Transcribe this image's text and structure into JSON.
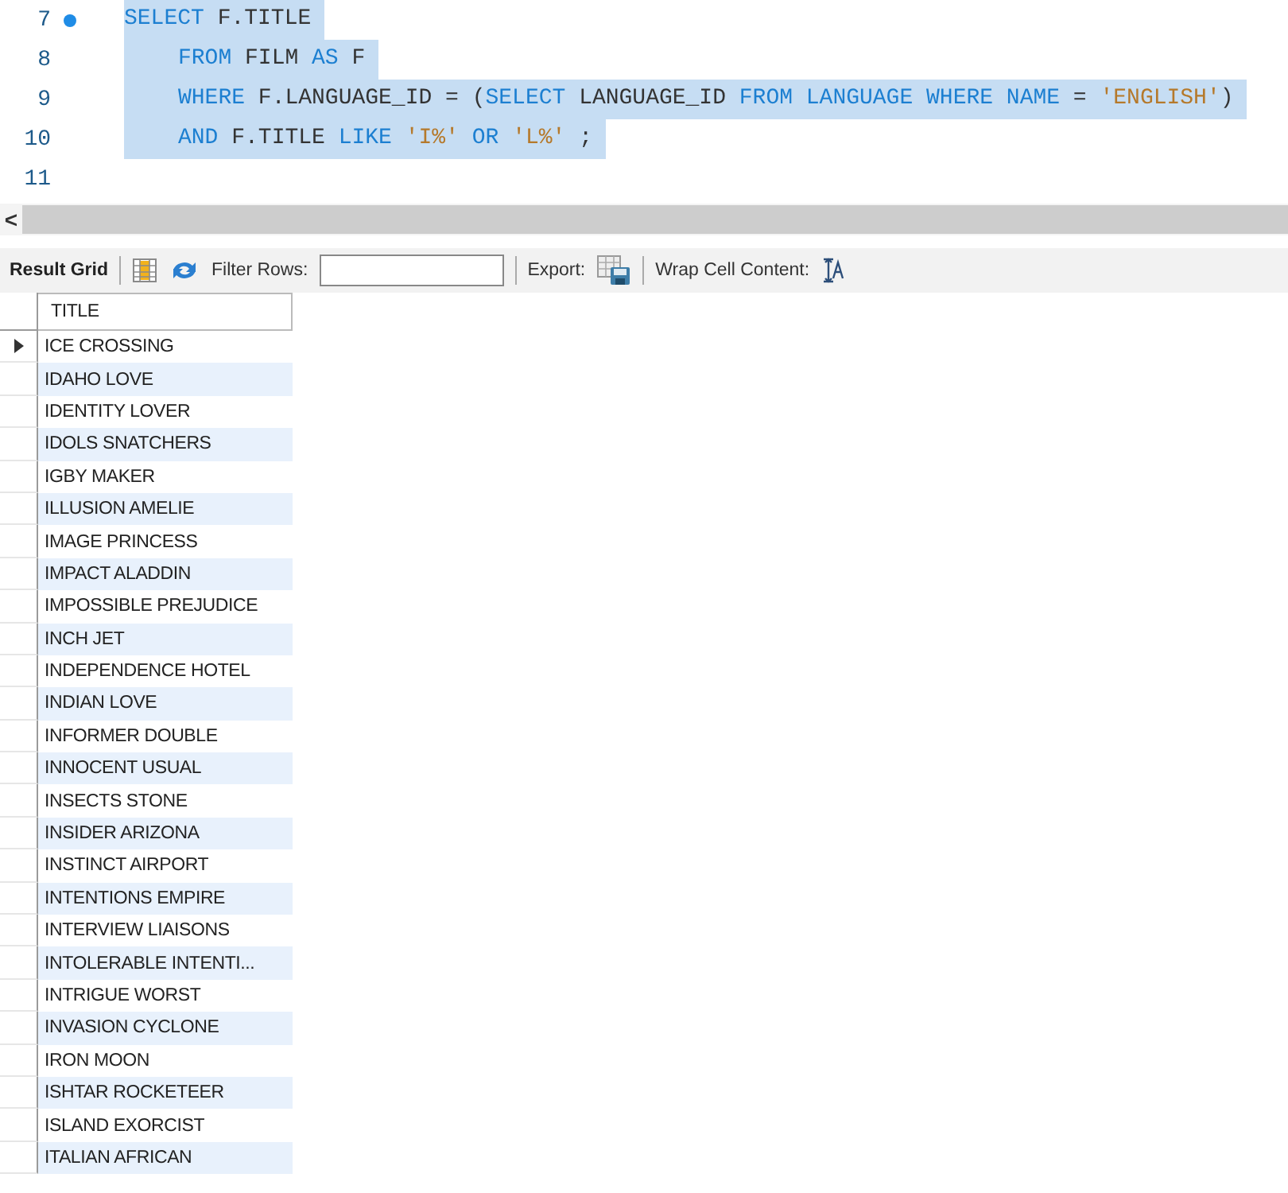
{
  "editor": {
    "lines": [
      {
        "number": "7",
        "marker": true,
        "selected": true,
        "indented": false,
        "tokens": [
          {
            "kind": "kw",
            "text": "SELECT"
          },
          {
            "kind": "plain",
            "text": " F.TITLE"
          }
        ]
      },
      {
        "number": "8",
        "marker": false,
        "selected": true,
        "indented": true,
        "tokens": [
          {
            "kind": "kw",
            "text": "FROM"
          },
          {
            "kind": "plain",
            "text": " FILM "
          },
          {
            "kind": "kw",
            "text": "AS"
          },
          {
            "kind": "plain",
            "text": " F"
          }
        ]
      },
      {
        "number": "9",
        "marker": false,
        "selected": true,
        "indented": true,
        "tokens": [
          {
            "kind": "kw",
            "text": "WHERE"
          },
          {
            "kind": "plain",
            "text": " F.LANGUAGE_ID = ("
          },
          {
            "kind": "kw",
            "text": "SELECT"
          },
          {
            "kind": "plain",
            "text": " LANGUAGE_ID "
          },
          {
            "kind": "kw",
            "text": "FROM LANGUAGE WHERE NAME"
          },
          {
            "kind": "plain",
            "text": " = "
          },
          {
            "kind": "str",
            "text": "'ENGLISH'"
          },
          {
            "kind": "plain",
            "text": ")"
          }
        ]
      },
      {
        "number": "10",
        "marker": false,
        "selected": true,
        "indented": true,
        "tokens": [
          {
            "kind": "kw",
            "text": "AND"
          },
          {
            "kind": "plain",
            "text": " F.TITLE "
          },
          {
            "kind": "kw",
            "text": "LIKE "
          },
          {
            "kind": "str",
            "text": "'I%'"
          },
          {
            "kind": "kw",
            "text": " OR "
          },
          {
            "kind": "str",
            "text": "'L%'"
          },
          {
            "kind": "plain",
            "text": " ;"
          }
        ]
      },
      {
        "number": "11",
        "marker": false
      }
    ]
  },
  "scrollbar": {
    "arrow": "<"
  },
  "toolbar": {
    "result_grid": "Result Grid",
    "filter_label": "Filter Rows:",
    "export_label": "Export:",
    "wrap_label": "Wrap Cell Content:"
  },
  "grid": {
    "columns": [
      "TITLE"
    ],
    "rows": [
      {
        "title": "ICE CROSSING",
        "current": true
      },
      {
        "title": "IDAHO LOVE",
        "current": false
      },
      {
        "title": "IDENTITY LOVER",
        "current": false
      },
      {
        "title": "IDOLS SNATCHERS",
        "current": false
      },
      {
        "title": "IGBY MAKER",
        "current": false
      },
      {
        "title": "ILLUSION AMELIE",
        "current": false
      },
      {
        "title": "IMAGE PRINCESS",
        "current": false
      },
      {
        "title": "IMPACT ALADDIN",
        "current": false
      },
      {
        "title": "IMPOSSIBLE PREJUDICE",
        "current": false
      },
      {
        "title": "INCH JET",
        "current": false
      },
      {
        "title": "INDEPENDENCE HOTEL",
        "current": false
      },
      {
        "title": "INDIAN LOVE",
        "current": false
      },
      {
        "title": "INFORMER DOUBLE",
        "current": false
      },
      {
        "title": "INNOCENT USUAL",
        "current": false
      },
      {
        "title": "INSECTS STONE",
        "current": false
      },
      {
        "title": "INSIDER ARIZONA",
        "current": false
      },
      {
        "title": "INSTINCT AIRPORT",
        "current": false
      },
      {
        "title": "INTENTIONS EMPIRE",
        "current": false
      },
      {
        "title": "INTERVIEW LIAISONS",
        "current": false
      },
      {
        "title": "INTOLERABLE INTENTI...",
        "current": false
      },
      {
        "title": "INTRIGUE WORST",
        "current": false
      },
      {
        "title": "INVASION CYCLONE",
        "current": false
      },
      {
        "title": "IRON MOON",
        "current": false
      },
      {
        "title": "ISHTAR ROCKETEER",
        "current": false
      },
      {
        "title": "ISLAND EXORCIST",
        "current": false
      },
      {
        "title": "ITALIAN AFRICAN",
        "current": false
      }
    ]
  }
}
